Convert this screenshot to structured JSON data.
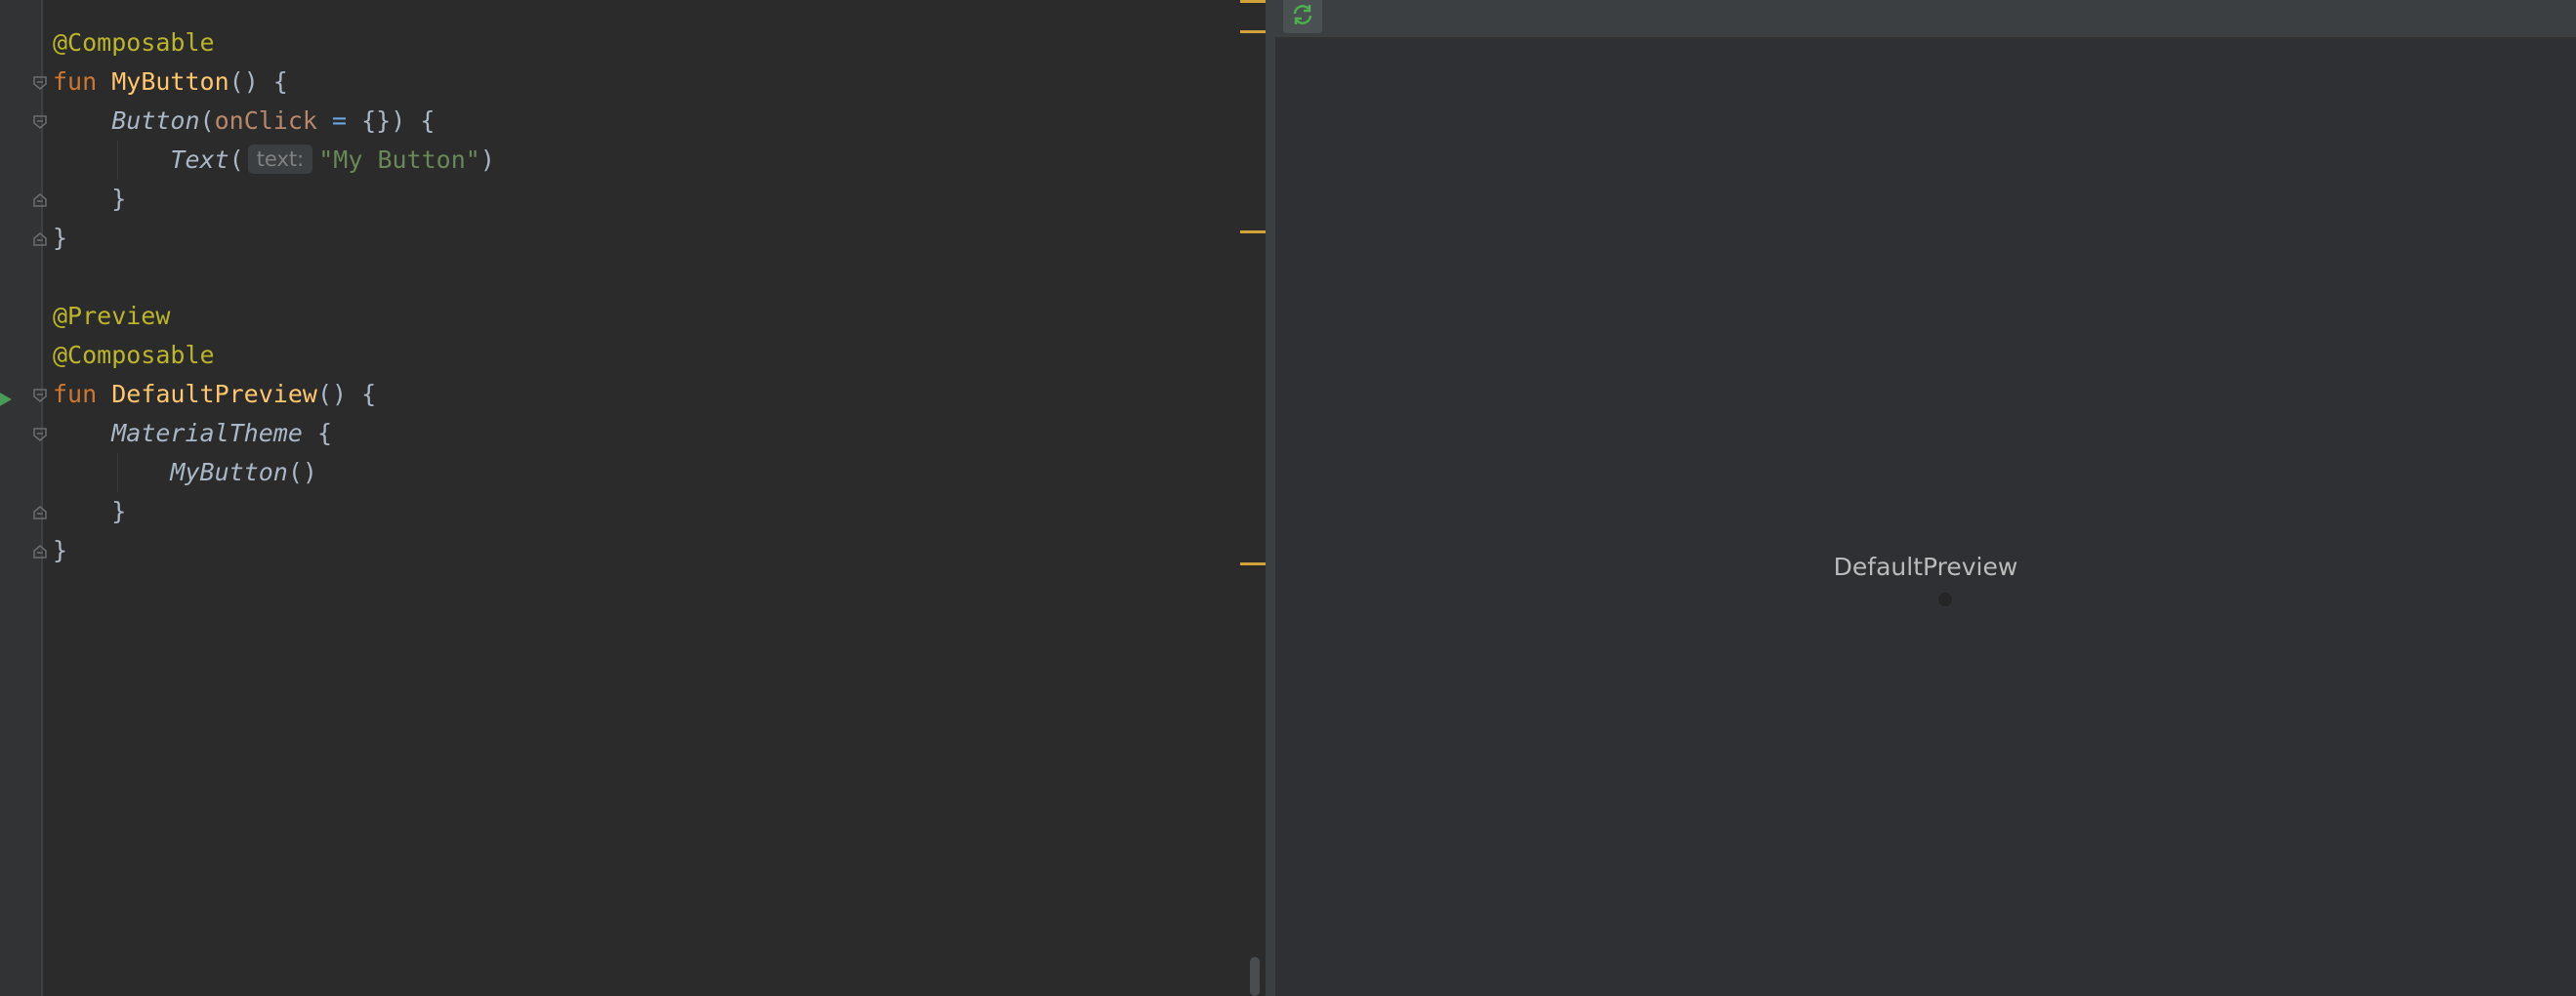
{
  "editor": {
    "lines": [
      {
        "segments": [
          [
            "ann",
            "@Composable"
          ]
        ]
      },
      {
        "segments": [
          [
            "kw",
            "fun "
          ],
          [
            "fn",
            "MyButton"
          ],
          [
            "br",
            "() {"
          ]
        ]
      },
      {
        "segments": [
          [
            "br",
            "    "
          ],
          [
            "call",
            "Button"
          ],
          [
            "br",
            "("
          ],
          [
            "param",
            "onClick"
          ],
          [
            "br",
            " "
          ],
          [
            "op",
            "="
          ],
          [
            "br",
            " {}) {"
          ]
        ]
      },
      {
        "segments": [
          [
            "br",
            "        "
          ],
          [
            "call",
            "Text"
          ],
          [
            "br",
            "("
          ],
          [
            "hint",
            "text:"
          ],
          [
            "str",
            "\"My Button\""
          ],
          [
            "br",
            ")"
          ]
        ]
      },
      {
        "segments": [
          [
            "br",
            "    }"
          ]
        ]
      },
      {
        "segments": [
          [
            "br",
            "}"
          ]
        ]
      },
      {
        "segments": []
      },
      {
        "segments": [
          [
            "ann",
            "@Preview"
          ]
        ]
      },
      {
        "segments": [
          [
            "ann",
            "@Composable"
          ]
        ]
      },
      {
        "segments": [
          [
            "kw",
            "fun "
          ],
          [
            "fn",
            "DefaultPreview"
          ],
          [
            "br",
            "() {"
          ]
        ]
      },
      {
        "segments": [
          [
            "br",
            "    "
          ],
          [
            "call",
            "MaterialTheme"
          ],
          [
            "br",
            " {"
          ]
        ]
      },
      {
        "segments": [
          [
            "br",
            "        "
          ],
          [
            "call",
            "MyButton"
          ],
          [
            "br",
            "()"
          ]
        ]
      },
      {
        "segments": [
          [
            "br",
            "    }"
          ]
        ]
      },
      {
        "segments": [
          [
            "br",
            "}"
          ]
        ]
      }
    ],
    "icons": {
      "run": "run-gutter-icon",
      "fold": "fold-marker-icon"
    }
  },
  "preview": {
    "toolbar": {
      "refresh_icon": "refresh-icon"
    },
    "component_label": "DefaultPreview"
  },
  "colors": {
    "editor_bg": "#2b2b2b",
    "annotation": "#bbb529",
    "keyword": "#cc7832",
    "function": "#ffc66d",
    "string": "#6a8759",
    "stripe_mark": "#d3a33a",
    "refresh_accent": "#4caf50"
  }
}
